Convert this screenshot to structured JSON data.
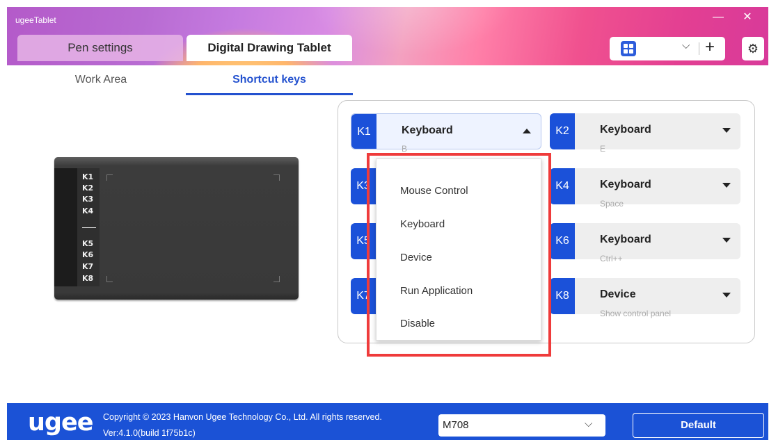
{
  "window": {
    "title": "ugeeTablet",
    "minimize": "—",
    "close": "✕"
  },
  "tabs": {
    "pen_settings": "Pen settings",
    "digital_tablet": "Digital Drawing Tablet"
  },
  "toolbar": {
    "device_icon": "grid-icon",
    "dropdown_glyph": "⌵",
    "add": "+",
    "settings_icon": "⚙"
  },
  "subtabs": {
    "work_area": "Work Area",
    "shortcut_keys": "Shortcut keys"
  },
  "tablet": {
    "keys": [
      "K1",
      "K2",
      "K3",
      "K4",
      "K5",
      "K6",
      "K7",
      "K8"
    ]
  },
  "shortcut_keys": [
    {
      "id": "K1",
      "type": "Keyboard",
      "value": "B",
      "open": true
    },
    {
      "id": "K2",
      "type": "Keyboard",
      "value": "E"
    },
    {
      "id": "K3",
      "type": "",
      "value": ""
    },
    {
      "id": "K4",
      "type": "Keyboard",
      "value": "Space"
    },
    {
      "id": "K5",
      "type": "",
      "value": ""
    },
    {
      "id": "K6",
      "type": "Keyboard",
      "value": "Ctrl++"
    },
    {
      "id": "K7",
      "type": "",
      "value": ""
    },
    {
      "id": "K8",
      "type": "Device",
      "value": "Show control panel"
    }
  ],
  "dropdown_options": [
    "Mouse Control",
    "Keyboard",
    "Device",
    "Run Application",
    "Disable"
  ],
  "footer": {
    "logo": "ugee",
    "copyright": "Copyright © 2023 Hanvon Ugee Technology Co., Ltd. All rights reserved.",
    "version": "Ver:4.1.0(build 1f75b1c)",
    "model": "M708",
    "default_button": "Default"
  },
  "colors": {
    "accent": "#1b51d9",
    "highlight": "#ef3b3b"
  }
}
